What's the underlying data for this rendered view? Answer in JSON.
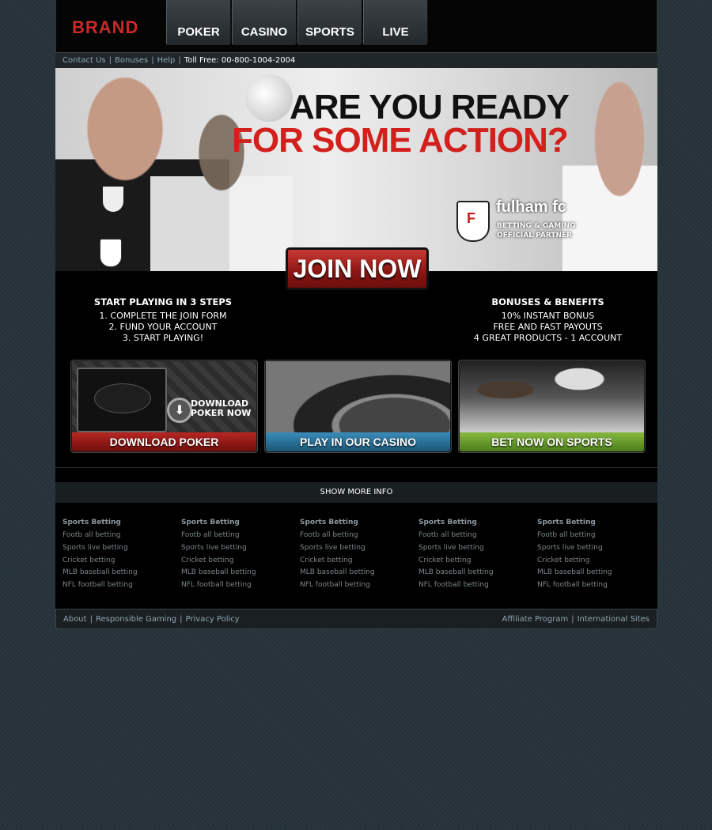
{
  "brand": "BRAND",
  "nav": [
    "POKER",
    "CASINO",
    "SPORTS",
    "LIVE"
  ],
  "topbar": {
    "links": [
      "Contact Us",
      "Bonuses",
      "Help"
    ],
    "toll_free": "Toll Free: 00-800-1004-2004"
  },
  "banner": {
    "headline_1": "ARE YOU READY",
    "headline_2": "FOR SOME ACTION?",
    "partner_name": "fulham fc",
    "partner_line_1": "BETTING & GAMING",
    "partner_line_2": "OFFICIAL PARTNER",
    "cta": "JOIN NOW"
  },
  "steps": {
    "title": "START PLAYING IN 3 STEPS",
    "items": [
      "1. COMPLETE THE JOIN FORM",
      "2. FUND YOUR ACCOUNT",
      "3. START PLAYING!"
    ]
  },
  "bonus": {
    "title": "BONUSES & BENEFITS",
    "items": [
      "10% INSTANT BONUS",
      "FREE AND FAST PAYOUTS",
      "4 GREAT PRODUCTS - 1 ACCOUNT"
    ]
  },
  "cards": {
    "poker": {
      "overlay_1": "DOWNLOAD",
      "overlay_2": "POKER NOW",
      "label": "DOWNLOAD POKER"
    },
    "casino": {
      "label": "PLAY IN OUR CASINO"
    },
    "sports": {
      "label": "BET NOW ON SPORTS"
    }
  },
  "more_info": "SHOW MORE INFO",
  "link_columns": [
    {
      "head": "Sports Betting",
      "links": [
        "Footb all betting",
        "Sports live betting",
        "Cricket betting",
        "MLB baseball betting",
        "NFL football betting"
      ]
    },
    {
      "head": "Sports Betting",
      "links": [
        "Footb all betting",
        "Sports live betting",
        "Cricket betting",
        "MLB baseball betting",
        "NFL football betting"
      ]
    },
    {
      "head": "Sports Betting",
      "links": [
        "Footb all betting",
        "Sports live betting",
        "Cricket betting",
        "MLB baseball betting",
        "NFL football betting"
      ]
    },
    {
      "head": "Sports Betting",
      "links": [
        "Footb all betting",
        "Sports live betting",
        "Cricket betting",
        "MLB baseball betting",
        "NFL football betting"
      ]
    },
    {
      "head": "Sports Betting",
      "links": [
        "Footb all betting",
        "Sports live betting",
        "Cricket betting",
        "MLB baseball betting",
        "NFL football betting"
      ]
    }
  ],
  "footer": {
    "left": [
      "About",
      "Responsible Gaming",
      "Privacy Policy"
    ],
    "right": [
      "Affiliate Program",
      "International Sites"
    ]
  }
}
